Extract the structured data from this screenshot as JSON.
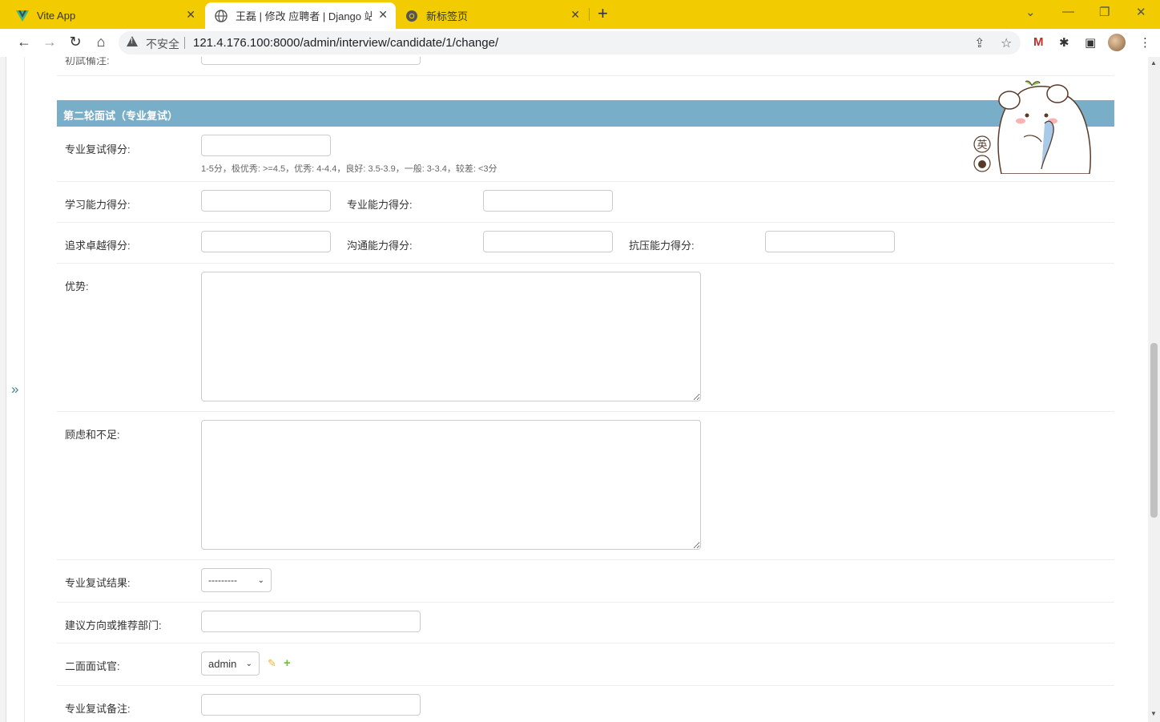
{
  "browser": {
    "tabs": [
      {
        "title": "Vite App",
        "active": false
      },
      {
        "title": "王磊 | 修改 应聘者 | Django 站点",
        "active": true
      },
      {
        "title": "新标签页",
        "active": false
      }
    ],
    "omnibox": {
      "security_label": "不安全",
      "url": "121.4.176.100:8000/admin/interview/candidate/1/change/"
    },
    "accent_color": "#f2cc00"
  },
  "sidebar": {
    "toggle_glyph": "»"
  },
  "previous_field": {
    "label": "初試備注:"
  },
  "fieldset": {
    "title": "第二轮面试（专业复试）",
    "header_color": "#79aec8"
  },
  "fields": {
    "second_score": {
      "label": "专业复试得分:",
      "help": "1-5分，极优秀: >=4.5，优秀: 4-4.4，良好: 3.5-3.9，一般: 3-3.4，较差: <3分"
    },
    "learning_ability": {
      "label": "学习能力得分:"
    },
    "professional_competency": {
      "label": "专业能力得分:"
    },
    "pursue_excellence": {
      "label": "追求卓越得分:"
    },
    "communication_ability": {
      "label": "沟通能力得分:"
    },
    "pressure_score": {
      "label": "抗压能力得分:"
    },
    "advantage": {
      "label": "优势:"
    },
    "disadvantage": {
      "label": "顾虑和不足:"
    },
    "second_result": {
      "label": "专业复试结果:",
      "selected": "---------"
    },
    "recommend_position": {
      "label": "建议方向或推荐部门:"
    },
    "second_interviewer": {
      "label": "二面面试官:",
      "selected": "admin"
    },
    "second_remark": {
      "label": "专业复试备注:"
    }
  },
  "sticker": {
    "badge_text": "英"
  }
}
